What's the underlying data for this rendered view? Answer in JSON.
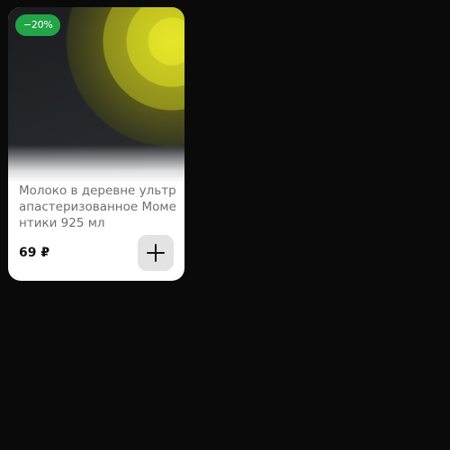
{
  "product_card": {
    "discount_badge": "−20%",
    "title": "Молоко в деревне ультрапастеризованное Моментики 925 мл",
    "price": "69 ₽",
    "add_button_icon": "plus-icon"
  },
  "colors": {
    "background": "#0a0a0a",
    "card": "#ffffff",
    "badge": "#22a447",
    "add_button": "#e3e3e3",
    "title_text": "#6f6f6f",
    "price_text": "#111111",
    "product_accent": "#e6e62a"
  }
}
